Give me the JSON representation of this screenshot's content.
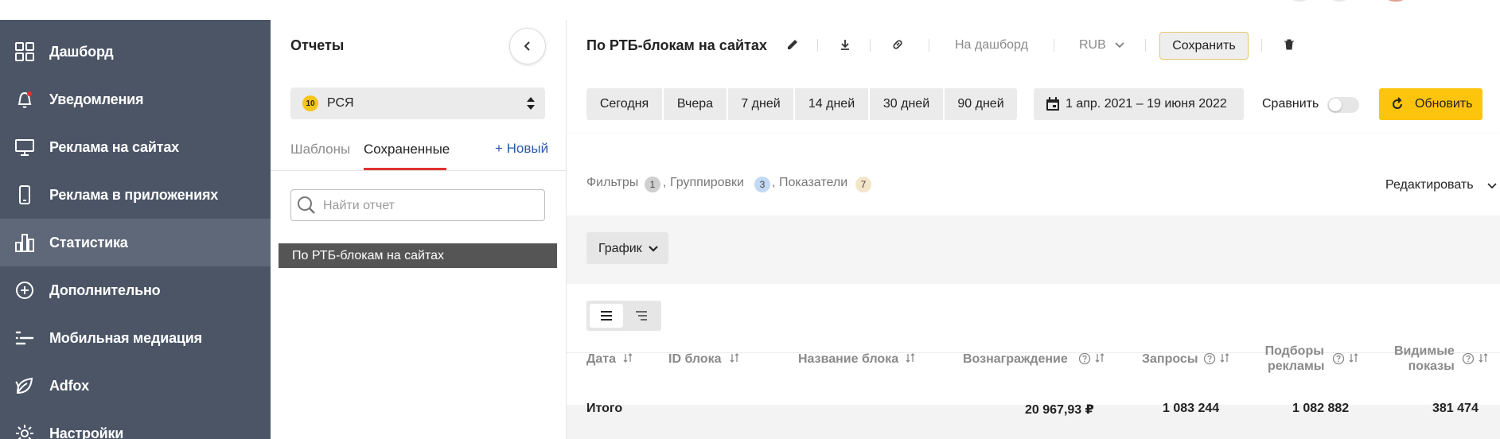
{
  "nav": {
    "items": [
      {
        "label": "Дашборд",
        "icon": "dashboard-grid-icon"
      },
      {
        "label": "Уведомления",
        "icon": "bell-icon"
      },
      {
        "label": "Реклама на сайтах",
        "icon": "monitor-icon"
      },
      {
        "label": "Реклама в приложениях",
        "icon": "smartphone-icon"
      },
      {
        "label": "Статистика",
        "icon": "bar-chart-icon",
        "active": true
      },
      {
        "label": "Дополнительно",
        "icon": "plus-circle-icon"
      },
      {
        "label": "Мобильная медиация",
        "icon": "mediation-icon"
      },
      {
        "label": "Adfox",
        "icon": "leaf-icon"
      },
      {
        "label": "Настройки",
        "icon": "gear-icon"
      }
    ]
  },
  "reports": {
    "title": "Отчеты",
    "product": {
      "badge": "10",
      "label": "РСЯ"
    },
    "tabs": {
      "templates": "Шаблоны",
      "saved": "Сохраненные"
    },
    "new_label": "+ Новый",
    "search_placeholder": "Найти отчет",
    "items": [
      "По РТБ-блокам на сайтах"
    ]
  },
  "header": {
    "title": "По РТБ-блокам на сайтах",
    "to_dashboard": "На дашборд",
    "currency": "RUB",
    "save_label": "Сохранить"
  },
  "period": {
    "buttons": [
      "Сегодня",
      "Вчера",
      "7 дней",
      "14 дней",
      "30 дней",
      "90 дней"
    ],
    "date_range": "1 апр. 2021 – 19 июня 2022",
    "compare_label": "Сравнить",
    "compare_on": false,
    "refresh_label": "Обновить"
  },
  "filters": {
    "filters_label": "Фильтры",
    "filters_count": "1",
    "groupings_label": "Группировки",
    "groupings_count": "3",
    "metrics_label": "Показатели",
    "metrics_count": "7",
    "separator": ",",
    "edit_label": "Редактировать"
  },
  "graph": {
    "label": "График"
  },
  "table": {
    "columns": {
      "date": "Дата",
      "block_id": "ID блока",
      "block_name": "Название блока",
      "reward": "Вознаграждение",
      "requests": "Запросы",
      "ad_picks_1": "Подборы",
      "ad_picks_2": "рекламы",
      "visible_1": "Видимые",
      "visible_2": "показы"
    },
    "total": {
      "label": "Итого",
      "reward": "20 967,93 ₽",
      "requests": "1 083 244",
      "ad_picks": "1 082 882",
      "visible": "381 474"
    }
  },
  "colors": {
    "nav_bg": "#4b5566",
    "nav_active": "#5f6878",
    "accent_yellow": "#fcc40d",
    "tab_underline": "#e0322f",
    "link_blue": "#2c5aa8"
  }
}
